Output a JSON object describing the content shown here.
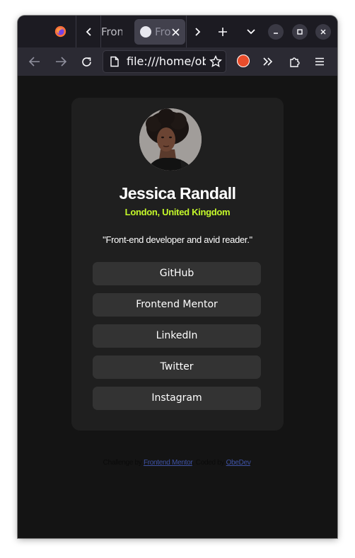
{
  "browser": {
    "inactive_tab_title": "Fronl",
    "active_tab_title": "Fro",
    "url": "file:///home/obe"
  },
  "profile": {
    "name": "Jessica Randall",
    "location": "London, United Kingdom",
    "bio": "\"Front-end developer and avid reader.\""
  },
  "links": [
    {
      "label": "GitHub"
    },
    {
      "label": "Frontend Mentor"
    },
    {
      "label": "LinkedIn"
    },
    {
      "label": "Twitter"
    },
    {
      "label": "Instagram"
    }
  ],
  "attribution": {
    "prefix": "Challenge by",
    "challenge_link": "Frontend Mentor",
    "middle": ". Coded by",
    "author_link": "ObeDev",
    "suffix": "."
  },
  "colors": {
    "accent": "#c4f82a",
    "card": "#1f1f1f",
    "button": "#333333",
    "background": "#141414"
  }
}
